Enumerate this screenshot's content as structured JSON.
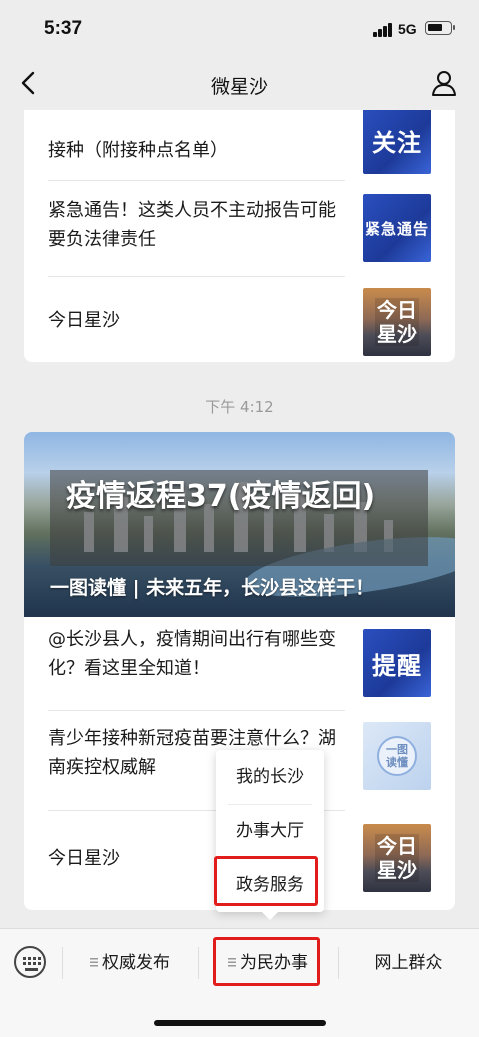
{
  "status_bar": {
    "time": "5:37",
    "network": "5G",
    "battery_level": 0.7
  },
  "nav": {
    "title": "微星沙",
    "back_icon": "chevron-left-icon",
    "profile_icon": "user-icon"
  },
  "feed": {
    "top_card": {
      "articles": [
        {
          "title": "接种（附接种点名单）",
          "thumb_text": "关注"
        },
        {
          "title": "紧急通告！这类人员不主动报告可能要负法律责任",
          "thumb_text": "紧急通告"
        },
        {
          "title": "今日星沙",
          "thumb_text_1": "今日",
          "thumb_text_2": "星沙"
        }
      ]
    },
    "timestamp": "下午 4:12",
    "bottom_card": {
      "hero_caption": "一图读懂 | 未来五年，长沙县这样干！",
      "articles": [
        {
          "title": "@长沙县人，疫情期间出行有哪些变化？看这里全知道！",
          "thumb_text": "提醒"
        },
        {
          "title": "青少年接种新冠疫苗要注意什么？湖南疾控权威解",
          "thumb_text_1": "一图",
          "thumb_text_2": "读懂"
        },
        {
          "title": "今日星沙",
          "thumb_text_1": "今日",
          "thumb_text_2": "星沙"
        }
      ]
    }
  },
  "overlay_headline": "疫情返程37(疫情返回)",
  "popup_menu": {
    "items": [
      "我的长沙",
      "办事大厅",
      "政务服务"
    ]
  },
  "bottom_menu": {
    "keyboard_icon": "keyboard-icon",
    "items": [
      "权威发布",
      "为民办事",
      "网上群众"
    ]
  },
  "colors": {
    "highlight": "#e21b1b",
    "thumb_blue": "#2a4fbf"
  }
}
